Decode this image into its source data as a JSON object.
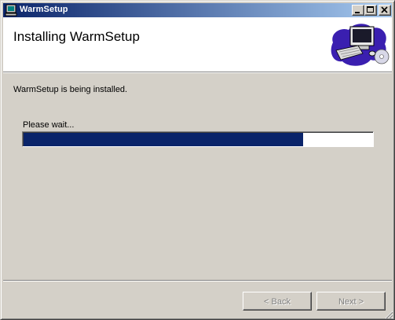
{
  "window": {
    "title": "WarmSetup",
    "icon": "setup-app-icon",
    "controls": {
      "minimize": "minimize-icon",
      "maximize": "maximize-icon",
      "close": "close-icon"
    }
  },
  "header": {
    "title": "Installing WarmSetup",
    "art_icon": "computer-installation-icon"
  },
  "body": {
    "status": "WarmSetup is being installed.",
    "wait_label": "Please wait...",
    "progress_fraction": 0.8
  },
  "footer": {
    "back_label": "< Back",
    "next_label": "Next >",
    "back_enabled": false,
    "next_enabled": false
  },
  "colors": {
    "title_bar_start": "#0a246a",
    "title_bar_end": "#a6caf0",
    "progress_fill": "#0a246a",
    "face": "#d4d0c8"
  }
}
